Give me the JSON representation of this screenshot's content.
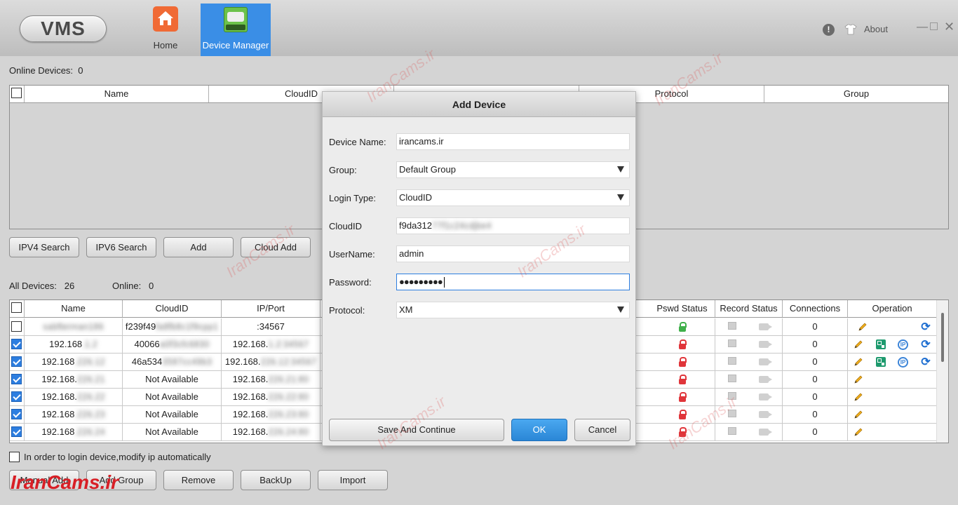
{
  "app": {
    "logo_text": "VMS",
    "about_label": "About"
  },
  "nav": {
    "home_label": "Home",
    "device_manager_label": "Device Manager"
  },
  "online": {
    "label": "Online Devices:",
    "count": "0",
    "columns": [
      "Name",
      "CloudID",
      "",
      "Protocol",
      "Group"
    ]
  },
  "online_buttons": [
    "IPV4 Search",
    "IPV6 Search",
    "Add",
    "Cloud Add"
  ],
  "all_devices": {
    "label": "All Devices:",
    "count": "26",
    "online_label": "Online:",
    "online_count": "0",
    "columns": [
      "Name",
      "CloudID",
      "IP/Port",
      "Pswd Status",
      "Record Status",
      "Connections",
      "Operation"
    ],
    "rows": [
      {
        "name": "sabfterman186",
        "cloudid": "f239f49",
        "cloudid_rest": "fa8fb8c1f9cpp1",
        "ip": "",
        "ip_rest": ":34567",
        "lock": "green",
        "checked": false,
        "connections": "0",
        "ops": "pencil,refresh"
      },
      {
        "name": "192.168",
        "name_rest": ".1.2",
        "cloudid": "40066",
        "cloudid_rest": "a0f3cfc6830",
        "ip": "192.168.",
        "ip_rest": "1.2:34567",
        "lock": "red",
        "checked": true,
        "connections": "0",
        "ops": "pencil,qr,ip,refresh"
      },
      {
        "name": "192.168",
        "name_rest": ".226.12",
        "cloudid": "46a534",
        "cloudid_rest": "3587cc49b3",
        "ip": "192.168.",
        "ip_rest": "226.12:34567",
        "lock": "red",
        "checked": true,
        "connections": "0",
        "ops": "pencil,qr,ip,refresh"
      },
      {
        "name": "192.168.",
        "name_rest": "226.21",
        "cloudid": "Not Available",
        "cloudid_rest": "",
        "ip": "192.168.",
        "ip_rest": "226.21:80",
        "lock": "red",
        "checked": true,
        "connections": "0",
        "ops": "pencil"
      },
      {
        "name": "192.168.",
        "name_rest": "226.22",
        "cloudid": "Not Available",
        "cloudid_rest": "",
        "ip": "192.168.",
        "ip_rest": "226.22:80",
        "lock": "red",
        "checked": true,
        "connections": "0",
        "ops": "pencil"
      },
      {
        "name": "192.168",
        "name_rest": ".226.23",
        "cloudid": "Not Available",
        "cloudid_rest": "",
        "ip": "192.168.",
        "ip_rest": "226.23:80",
        "lock": "red",
        "checked": true,
        "connections": "0",
        "ops": "pencil"
      },
      {
        "name": "192.168",
        "name_rest": ".226.24",
        "cloudid": "Not Available",
        "cloudid_rest": "",
        "ip": "192.168.",
        "ip_rest": "226.24:80",
        "lock": "red",
        "checked": true,
        "connections": "0",
        "ops": "pencil"
      }
    ]
  },
  "auto_ip_label": "In order to login device,modify ip automatically",
  "bottom_buttons": [
    "Manual Add",
    "Add Group",
    "Remove",
    "BackUp",
    "Import"
  ],
  "dialog": {
    "title": "Add Device",
    "device_name_label": "Device Name:",
    "device_name": "irancams.ir",
    "group_label": "Group:",
    "group": "Default Group",
    "login_type_label": "Login Type:",
    "login_type": "CloudID",
    "cloudid_label": "CloudID",
    "cloudid_visible": "f9da312",
    "cloudid_blurred": "77f1c24cdjbe4",
    "username_label": "UserName:",
    "username": "admin",
    "password_label": "Password:",
    "password": "●●●●●●●●●",
    "protocol_label": "Protocol:",
    "protocol": "XM",
    "save_continue": "Save And Continue",
    "ok": "OK",
    "cancel": "Cancel"
  },
  "watermark": "IranCams.ir",
  "colors": {
    "accent": "#3a8ee6",
    "lock_red": "#e0353a",
    "lock_green": "#3fb04a",
    "watermark": "#d81f26"
  }
}
